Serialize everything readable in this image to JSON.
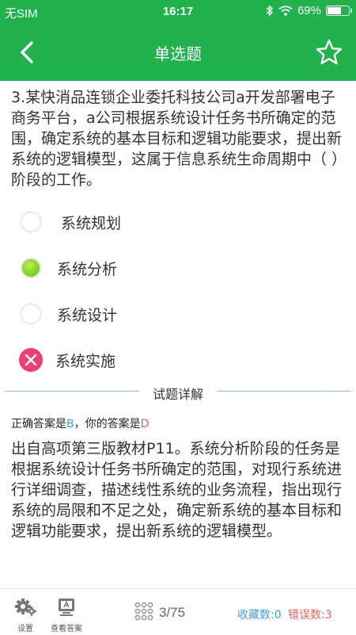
{
  "status_bar": {
    "carrier": "无SIM",
    "time": "16:17",
    "battery": "69%",
    "battery_level": 0.69
  },
  "header": {
    "title": "单选题",
    "back_icon": "chevron-left-icon",
    "favorite_icon": "star-outline-icon"
  },
  "question": {
    "text": "3.某快消品连锁企业委托科技公司a开发部署电子商务平台，a公司根据系统设计任务书所确定的范围，确定系统的基本目标和逻辑功能要求，提出新系统的逻辑模型，这属于信息系统生命周期中（ ）阶段的工作。",
    "options": [
      {
        "label": "系统规划",
        "state": "unselected"
      },
      {
        "label": "系统分析",
        "state": "correct"
      },
      {
        "label": "系统设计",
        "state": "unselected"
      },
      {
        "label": "系统实施",
        "state": "wrong"
      }
    ]
  },
  "detail": {
    "title": "试题详解",
    "correct_prefix": "正确答案是",
    "correct_answer": "B",
    "separator": "，你的答案是",
    "your_answer": "D",
    "explanation": "出自高项第三版教材P11。系统分析阶段的任务是根据系统设计任务书所确定的范围，对现行系统进行详细调查，描述线性系统的业务流程，指出现行系统的局限和不足之处，确定新系统的基本目标和逻辑功能要求，提出新系统的逻辑模型。"
  },
  "bottom_bar": {
    "settings_label": "设置",
    "view_answer_label": "查看答案",
    "progress": "3/75",
    "favorites": "收藏数:0",
    "errors": "错误数:3",
    "colors": {
      "blue": "#3aa0e6",
      "red": "#f0605a",
      "green": "#21b14d"
    }
  }
}
